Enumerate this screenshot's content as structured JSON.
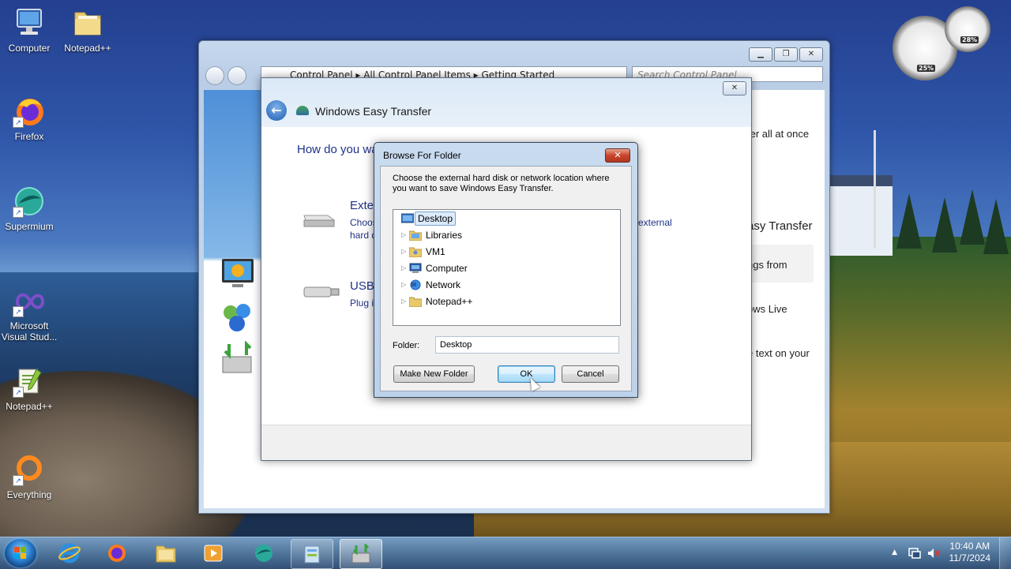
{
  "desktop": {
    "icons": [
      {
        "label": "Computer"
      },
      {
        "label": "Notepad++"
      },
      {
        "label": "Firefox"
      },
      {
        "label": "Supermium"
      },
      {
        "label": "Microsoft Visual Stud..."
      },
      {
        "label": "Notepad++"
      },
      {
        "label": "Everything"
      }
    ]
  },
  "gadget": {
    "cpu": "25%",
    "memory": "28%"
  },
  "explorer": {
    "address": "Control Panel  ▸  All Control Panel Items  ▸  Getting Started",
    "search_placeholder": "Search Control Panel",
    "right_snippets": [
      "ter all at once",
      "asy Transfer",
      "ngs from",
      "ows Live",
      "e text on your"
    ]
  },
  "transfer": {
    "title": "Windows Easy Transfer",
    "heading": "How do you want to transfer items to your new computer?",
    "option1_title": "Exter",
    "option1_desc_a": "Choos",
    "option1_desc_b": "hard d",
    "option1_desc_right": "external",
    "option2_title": "USB",
    "option2_desc": "Plug i"
  },
  "browse": {
    "title": "Browse For Folder",
    "close_label": "✕",
    "description": "Choose the external hard disk or network location where you want to save Windows Easy Transfer.",
    "tree": [
      {
        "label": "Desktop"
      },
      {
        "label": "Libraries"
      },
      {
        "label": "VM1"
      },
      {
        "label": "Computer"
      },
      {
        "label": "Network"
      },
      {
        "label": "Notepad++"
      }
    ],
    "folder_label": "Folder:",
    "folder_value": "Desktop",
    "make_new_folder": "Make New Folder",
    "ok": "OK",
    "cancel": "Cancel"
  },
  "taskbar": {
    "time": "10:40 AM",
    "date": "11/7/2024"
  },
  "colors": {
    "heading_blue": "#1e3287",
    "selection": "#dcebfc",
    "close_red": "#c7442b"
  }
}
